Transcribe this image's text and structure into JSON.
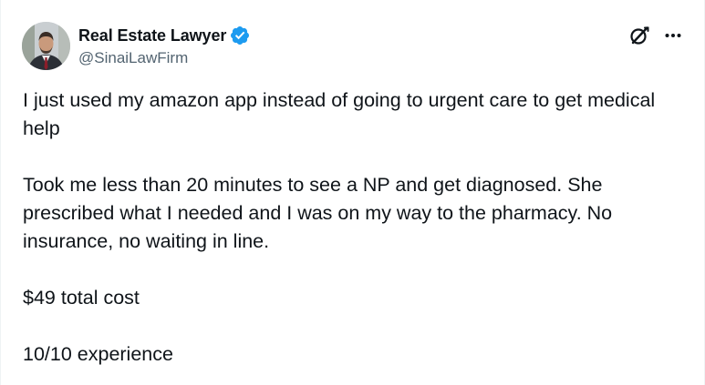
{
  "author": {
    "display_name": "Real Estate Lawyer",
    "handle": "@SinaiLawFirm",
    "verified": true,
    "avatar": "profile-photo-man-in-suit"
  },
  "actions": {
    "grok_icon": "grok-icon",
    "more_icon": "more-horizontal-icon"
  },
  "post": {
    "paragraphs": [
      "I just used my amazon app instead of going to urgent care to get medical help",
      "Took me less than 20 minutes to see a NP and get diagnosed. She prescribed what I needed and I was on my way to the pharmacy. No insurance, no waiting in line.",
      "$49 total cost",
      "10/10 experience"
    ]
  },
  "colors": {
    "verified_blue": "#1d9bf0",
    "text_primary": "#0f1419",
    "text_secondary": "#536471"
  }
}
